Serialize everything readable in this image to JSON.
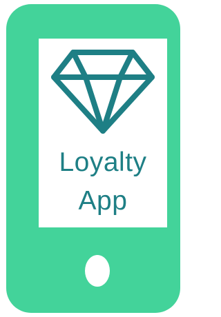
{
  "app": {
    "title_line1": "Loyalty",
    "title_line2": "App"
  },
  "icons": {
    "diamond": "diamond-icon"
  },
  "colors": {
    "phone_body": "#43d39a",
    "screen": "#ffffff",
    "accent": "#1e7f85"
  }
}
